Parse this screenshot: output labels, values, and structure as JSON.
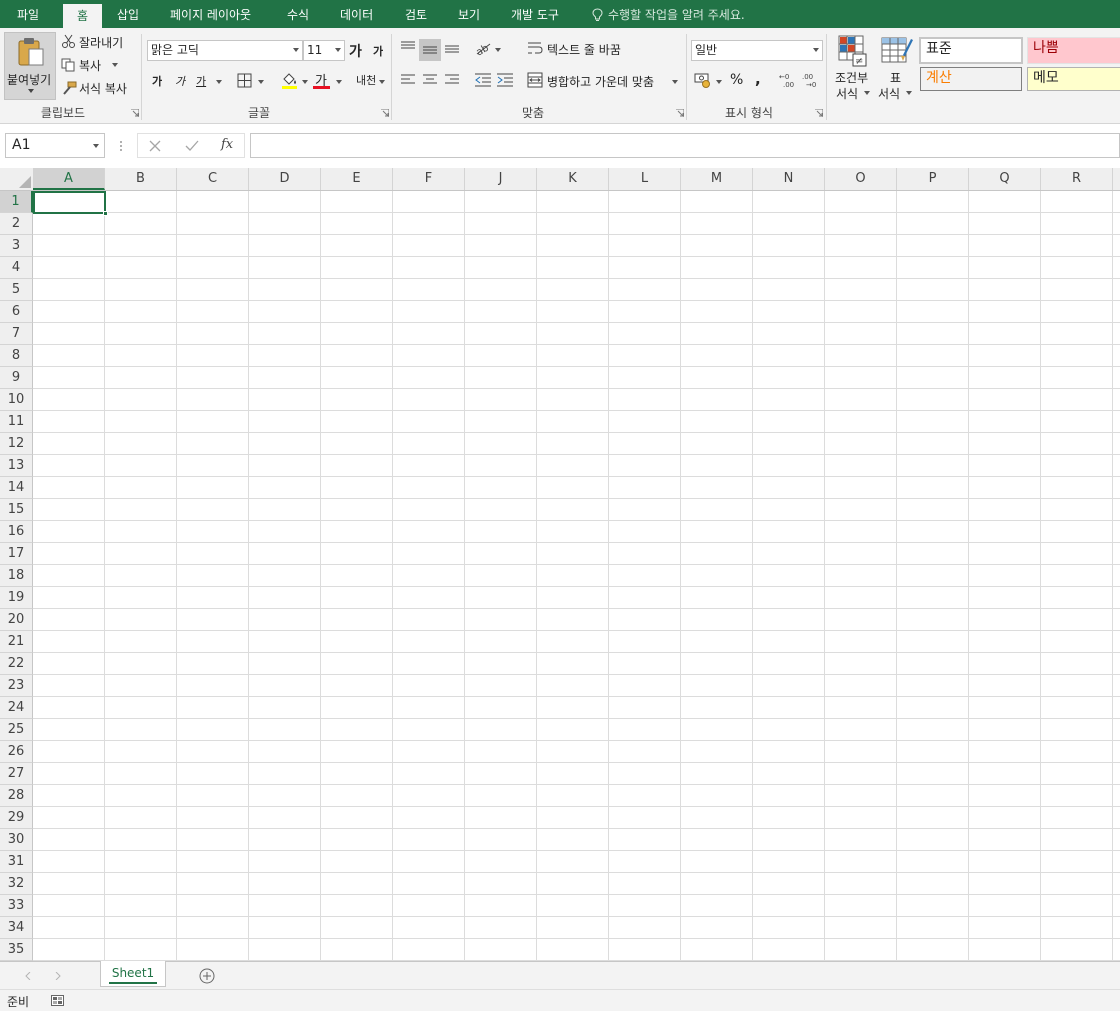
{
  "menu": {
    "tabs": [
      "파일",
      "홈",
      "삽입",
      "페이지 레이아웃",
      "수식",
      "데이터",
      "검토",
      "보기",
      "개발 도구"
    ],
    "active_tab": "홈",
    "tell_me": "수행할 작업을 알려 주세요."
  },
  "ribbon": {
    "clipboard": {
      "paste": "붙여넣기",
      "cut": "잘라내기",
      "copy": "복사",
      "format_painter": "서식 복사",
      "label": "클립보드"
    },
    "font": {
      "name": "맑은 고딕",
      "size": "11",
      "grow": "가",
      "shrink": "가",
      "bold": "가",
      "italic": "가",
      "underline": "가",
      "font_color": "가",
      "phonetic": "내천",
      "label": "글꼴"
    },
    "alignment": {
      "wrap_text": "텍스트 줄 바꿈",
      "merge_center": "병합하고 가운데 맞춤",
      "label": "맞춤"
    },
    "number": {
      "format": "일반",
      "percent": "%",
      "comma": ",",
      "label": "표시 형식"
    },
    "styles": {
      "conditional_line1": "조건부",
      "conditional_line2": "서식",
      "table_line1": "표",
      "table_line2": "서식",
      "normal": "표준",
      "bad": "나쁨",
      "calculation": "계산",
      "note": "메모"
    }
  },
  "formula_bar": {
    "name_box": "A1",
    "fx": "fx",
    "formula": ""
  },
  "grid": {
    "columns": [
      "A",
      "B",
      "C",
      "D",
      "E",
      "F",
      "J",
      "K",
      "L",
      "M",
      "N",
      "O",
      "P",
      "Q",
      "R"
    ],
    "rows": [
      "1",
      "2",
      "3",
      "4",
      "5",
      "6",
      "7",
      "8",
      "9",
      "10",
      "11",
      "12",
      "13",
      "14",
      "15",
      "16",
      "17",
      "18",
      "19",
      "20",
      "21",
      "22",
      "23",
      "24",
      "25",
      "26",
      "27",
      "28",
      "29",
      "30",
      "31",
      "32",
      "33",
      "34",
      "35"
    ],
    "selected_cell": "A1"
  },
  "sheets": {
    "tabs": [
      "Sheet1"
    ]
  },
  "status": {
    "ready": "준비"
  },
  "colors": {
    "accent": "#217346",
    "bad_bg": "#ffc7ce",
    "bad_text": "#9c0006",
    "calc_bg": "#f2f2f2",
    "calc_text": "#fa7d00",
    "note_bg": "#ffffcc"
  }
}
